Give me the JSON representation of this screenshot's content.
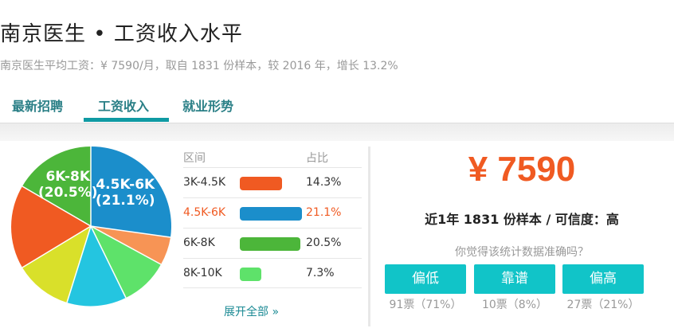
{
  "header": {
    "title": "南京医生 • 工资收入水平",
    "subtitle": "南京医生平均工资：¥ 7590/月，取自 1831 份样本，较 2016 年，增长 13.2%"
  },
  "tabs": [
    {
      "label": "最新招聘"
    },
    {
      "label": "工资收入"
    },
    {
      "label": "就业形势"
    }
  ],
  "active_tab": "工资收入",
  "distribution": {
    "col_range": "区间",
    "col_share": "占比",
    "rows": [
      {
        "range": "3K-4.5K",
        "share": "14.3%",
        "value": 14.3,
        "color": "#f05a22"
      },
      {
        "range": "4.5K-6K",
        "share": "21.1%",
        "value": 21.1,
        "color": "#1b8ecb",
        "active": true
      },
      {
        "range": "6K-8K",
        "share": "20.5%",
        "value": 20.5,
        "color": "#4cb63a"
      },
      {
        "range": "8K-10K",
        "share": "7.3%",
        "value": 7.3,
        "color": "#5ee26a"
      }
    ],
    "expand_label": "展开全部 »"
  },
  "pie_labels": {
    "a": "6K-8K\n(20.5%)",
    "b": "4.5K-6K\n(21.1%)"
  },
  "salary": {
    "amount": "¥ 7590",
    "summary": "近1年 1831 份样本 / 可信度：高",
    "question": "你觉得该统计数据准确吗？"
  },
  "votes": [
    {
      "label": "偏低",
      "count": "91票（71%）"
    },
    {
      "label": "靠谱",
      "count": "10票（8%）"
    },
    {
      "label": "偏高",
      "count": "27票（21%）"
    }
  ],
  "colors": {
    "accent_teal": "#0f9aa3",
    "accent_orange": "#f05a22",
    "vote_button": "#11c4c8"
  }
}
